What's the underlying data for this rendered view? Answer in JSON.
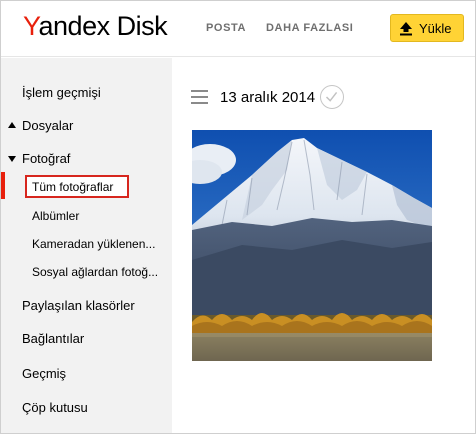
{
  "header": {
    "logo_y": "Y",
    "logo_rest": "andex Disk",
    "nav": [
      {
        "label": "POSTA"
      },
      {
        "label": "DAHA FAZLASI"
      }
    ],
    "upload_label": "Yükle"
  },
  "sidebar": {
    "items": [
      {
        "label": "İşlem geçmişi"
      },
      {
        "label": "Dosyalar",
        "expander": "collapsed"
      },
      {
        "label": "Fotoğraf",
        "expander": "expanded"
      },
      {
        "label": "Tüm fotoğraflar",
        "active": true
      },
      {
        "label": "Albümler"
      },
      {
        "label": "Kameradan yüklenen..."
      },
      {
        "label": "Sosyal ağlardan fotoğ..."
      },
      {
        "label": "Paylaşılan klasörler"
      },
      {
        "label": "Bağlantılar"
      },
      {
        "label": "Geçmiş"
      },
      {
        "label": "Çöp kutusu"
      }
    ]
  },
  "main": {
    "date_heading": "13 aralık 2014",
    "photo_icon": "mountain-landscape-photo"
  },
  "colors": {
    "accent_red": "#e8200c",
    "upload_yellow": "#ffd335",
    "sidebar_bg": "#f2f2f2"
  }
}
